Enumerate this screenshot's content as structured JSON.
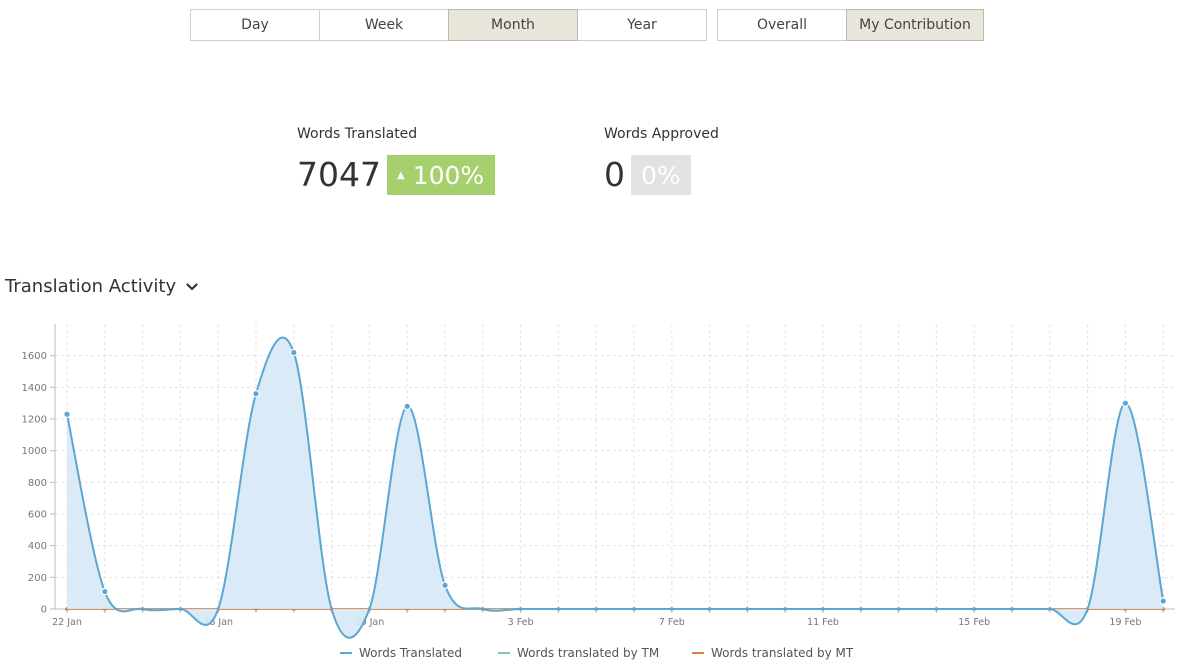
{
  "period_tabs": [
    {
      "label": "Day",
      "active": false
    },
    {
      "label": "Week",
      "active": false
    },
    {
      "label": "Month",
      "active": true
    },
    {
      "label": "Year",
      "active": false
    }
  ],
  "scope_tabs": [
    {
      "label": "Overall",
      "active": false
    },
    {
      "label": "My Contribution",
      "active": true
    }
  ],
  "stats": {
    "translated": {
      "label": "Words Translated",
      "value": "7047",
      "change": "100%",
      "arrow": "▲",
      "badge_color": "#a6cf6e"
    },
    "approved": {
      "label": "Words Approved",
      "value": "0",
      "change": "0%",
      "badge_color": "#e2e2e2"
    }
  },
  "section": {
    "title": "Translation Activity",
    "chevron_icon": "chevron-down-icon"
  },
  "colors": {
    "translated": "#5ba6d3",
    "area": "#d6e8f5",
    "tm": "#7dc9a7",
    "mt": "#e07b45",
    "grid": "#e3e3e3",
    "axis": "#bbbbbb"
  },
  "chart_data": {
    "type": "area",
    "title": "Translation Activity",
    "xlabel": "",
    "ylabel": "",
    "ylim": [
      0,
      1800
    ],
    "yticks": [
      0,
      200,
      400,
      600,
      800,
      1000,
      1200,
      1400,
      1600
    ],
    "x_tick_labels": [
      "22 Jan",
      "26 Jan",
      "30 Jan",
      "3 Feb",
      "7 Feb",
      "11 Feb",
      "15 Feb",
      "19 Feb"
    ],
    "x_tick_indices": [
      0,
      4,
      8,
      12,
      16,
      20,
      24,
      28
    ],
    "categories": [
      "22 Jan",
      "23 Jan",
      "24 Jan",
      "25 Jan",
      "26 Jan",
      "27 Jan",
      "28 Jan",
      "29 Jan",
      "30 Jan",
      "31 Jan",
      "1 Feb",
      "2 Feb",
      "3 Feb",
      "4 Feb",
      "5 Feb",
      "6 Feb",
      "7 Feb",
      "8 Feb",
      "9 Feb",
      "10 Feb",
      "11 Feb",
      "12 Feb",
      "13 Feb",
      "14 Feb",
      "15 Feb",
      "16 Feb",
      "17 Feb",
      "18 Feb",
      "19 Feb",
      "20 Feb"
    ],
    "grid": true,
    "legend_position": "bottom",
    "series": [
      {
        "name": "Words Translated",
        "values": [
          1230,
          110,
          0,
          0,
          0,
          1360,
          1620,
          0,
          0,
          1280,
          150,
          0,
          0,
          0,
          0,
          0,
          0,
          0,
          0,
          0,
          0,
          0,
          0,
          0,
          0,
          0,
          0,
          0,
          1300,
          50
        ]
      },
      {
        "name": "Words translated by TM",
        "values": [
          0,
          0,
          0,
          0,
          0,
          0,
          0,
          0,
          0,
          0,
          0,
          0,
          0,
          0,
          0,
          0,
          0,
          0,
          0,
          0,
          0,
          0,
          0,
          0,
          0,
          0,
          0,
          0,
          0,
          0
        ]
      },
      {
        "name": "Words translated by MT",
        "values": [
          0,
          0,
          0,
          0,
          0,
          0,
          0,
          0,
          0,
          0,
          0,
          0,
          0,
          0,
          0,
          0,
          0,
          0,
          0,
          0,
          0,
          0,
          0,
          0,
          0,
          0,
          0,
          0,
          0,
          0
        ]
      }
    ]
  }
}
